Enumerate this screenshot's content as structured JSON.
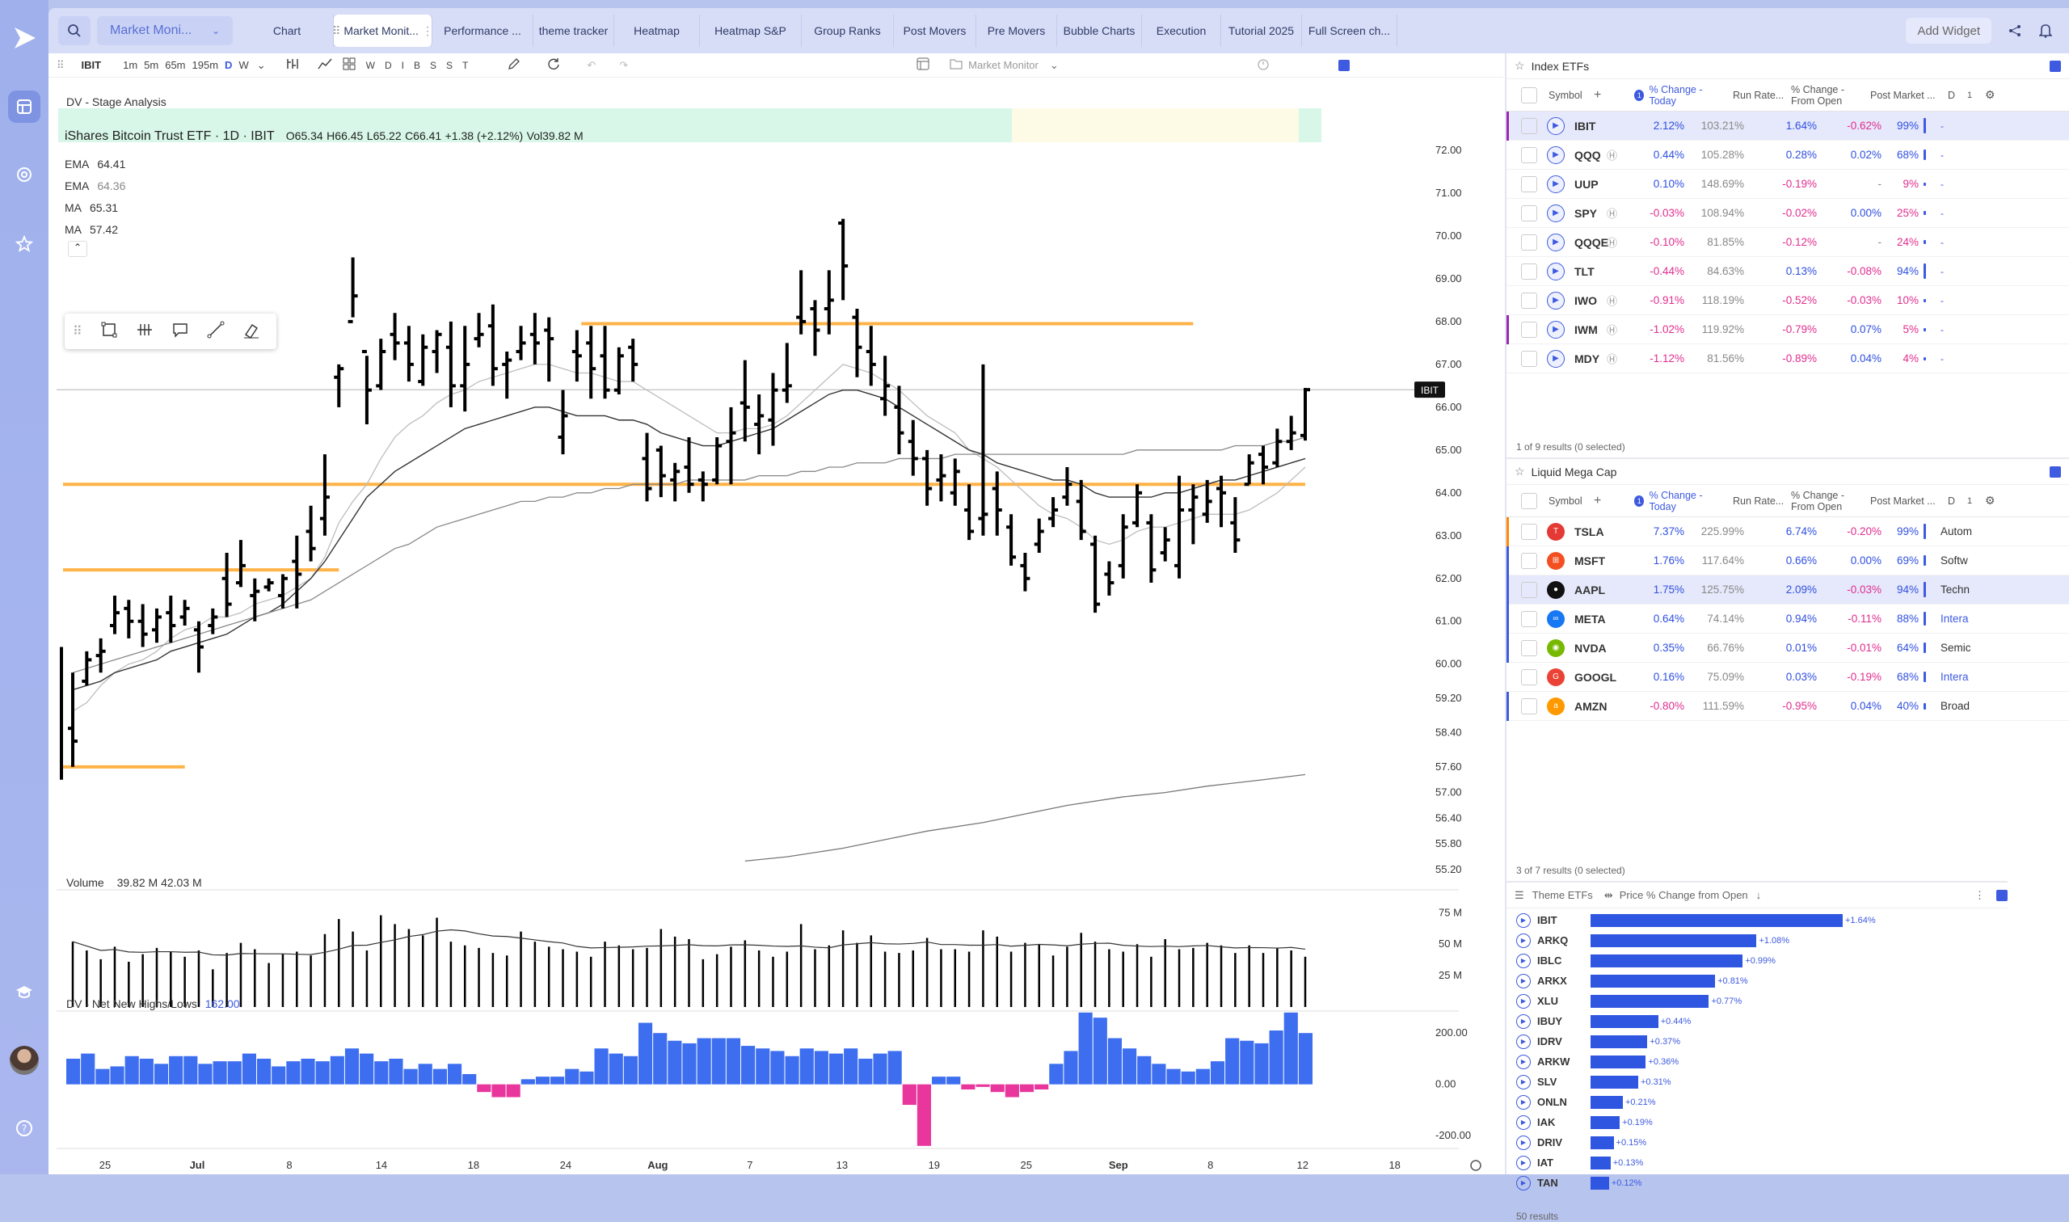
{
  "app": {
    "tabs": [
      "Chart",
      "Market Monit...",
      "Performance ...",
      "theme tracker",
      "Heatmap",
      "Heatmap S&P",
      "Group Ranks",
      "Post Movers",
      "Pre Movers",
      "Bubble Charts",
      "Execution",
      "Tutorial 2025",
      "Full Screen ch..."
    ],
    "layout_select": "Market Moni...",
    "add_widget": "Add Widget"
  },
  "chart": {
    "toolbar": {
      "symbol": "IBIT",
      "timeframes": [
        "1m",
        "5m",
        "65m",
        "195m",
        "D",
        "W"
      ],
      "letters": [
        "W",
        "D",
        "I",
        "B",
        "S",
        "S",
        "T"
      ],
      "layout_name": "Market Monitor"
    },
    "stage_label": "DV - Stage Analysis",
    "title": "iShares Bitcoin Trust ETF · 1D · IBIT",
    "ohlc": {
      "o": "O65.34",
      "h": "H66.45",
      "l": "L65.22",
      "c": "C66.41",
      "chg": "+1.38 (+2.12%)",
      "vol": "Vol39.82 M"
    },
    "indicators": [
      {
        "name": "EMA",
        "value": "64.41"
      },
      {
        "name": "EMA",
        "value": "64.36"
      },
      {
        "name": "MA",
        "value": "65.31"
      },
      {
        "name": "MA",
        "value": "57.42"
      }
    ],
    "price_label": "IBIT",
    "volume_label": "Volume",
    "volume_vals": "39.82 M  42.03 M",
    "nh_label": "DV - Net New Highs/Lows",
    "nh_value": "162.00",
    "price_ticks": [
      "72.00",
      "71.00",
      "70.00",
      "69.00",
      "68.00",
      "67.00",
      "66.00",
      "65.00",
      "64.00",
      "63.00",
      "62.00",
      "61.00",
      "60.00",
      "59.20",
      "58.40",
      "57.60",
      "57.00",
      "56.40",
      "55.80",
      "55.20"
    ],
    "volume_ticks": [
      "75 M",
      "50 M",
      "25 M"
    ],
    "nh_ticks": [
      "200.00",
      "0.00",
      "-200.00"
    ],
    "date_ticks": [
      "25",
      "Jul",
      "8",
      "14",
      "18",
      "24",
      "Aug",
      "7",
      "13",
      "19",
      "25",
      "Sep",
      "8",
      "12",
      "18"
    ]
  },
  "chart_data": {
    "type": "ohlc",
    "symbol": "IBIT",
    "ylim": [
      55.2,
      72.0
    ],
    "bars": [
      [
        58.5,
        59.8,
        57.6,
        58.2
      ],
      [
        59.6,
        60.3,
        59.5,
        60.1
      ],
      [
        60.2,
        60.6,
        59.8,
        60.3
      ],
      [
        60.9,
        61.6,
        60.7,
        61.2
      ],
      [
        61.3,
        61.5,
        60.6,
        61.0
      ],
      [
        61.0,
        61.4,
        60.4,
        60.7
      ],
      [
        60.8,
        61.3,
        60.5,
        61.1
      ],
      [
        61.2,
        61.6,
        60.5,
        60.9
      ],
      [
        61.1,
        61.5,
        60.9,
        61.3
      ],
      [
        60.8,
        61.0,
        59.8,
        60.4
      ],
      [
        60.9,
        61.3,
        60.7,
        61.1
      ],
      [
        62.0,
        62.6,
        61.1,
        61.4
      ],
      [
        61.9,
        62.9,
        61.8,
        62.3
      ],
      [
        61.6,
        62.0,
        61.0,
        61.7
      ],
      [
        61.8,
        62.0,
        61.7,
        61.9
      ],
      [
        61.6,
        62.1,
        61.3,
        62.0
      ],
      [
        62.4,
        63.0,
        61.3,
        62.1
      ],
      [
        63.1,
        63.7,
        62.4,
        62.7
      ],
      [
        63.4,
        64.9,
        63.0,
        63.9
      ],
      [
        66.7,
        67.0,
        66.0,
        66.9
      ],
      [
        68.0,
        69.5,
        68.1,
        68.6
      ],
      [
        67.3,
        67.2,
        65.6,
        66.4
      ],
      [
        66.5,
        67.6,
        66.4,
        67.3
      ],
      [
        67.7,
        68.2,
        67.1,
        67.5
      ],
      [
        67.5,
        67.9,
        66.6,
        67.0
      ],
      [
        66.6,
        67.7,
        66.5,
        67.4
      ],
      [
        67.3,
        67.8,
        66.8,
        67.7
      ],
      [
        67.4,
        68.0,
        66.0,
        66.5
      ],
      [
        66.5,
        67.9,
        65.9,
        67.0
      ],
      [
        67.6,
        68.2,
        67.4,
        67.7
      ],
      [
        67.9,
        68.4,
        66.5,
        66.9
      ],
      [
        67.0,
        67.3,
        66.2,
        67.1
      ],
      [
        67.3,
        67.9,
        67.1,
        67.5
      ],
      [
        67.7,
        68.2,
        67.0,
        67.5
      ],
      [
        67.8,
        68.1,
        66.6,
        67.6
      ],
      [
        65.3,
        66.4,
        64.9,
        65.8
      ],
      [
        67.3,
        67.8,
        66.6,
        67.2
      ],
      [
        67.5,
        67.9,
        66.2,
        66.9
      ],
      [
        67.2,
        67.9,
        66.2,
        66.4
      ],
      [
        66.4,
        67.4,
        66.3,
        67.2
      ],
      [
        67.4,
        67.6,
        66.6,
        67.0
      ],
      [
        64.8,
        65.4,
        63.8,
        64.1
      ],
      [
        65.0,
        65.1,
        63.9,
        64.4
      ],
      [
        64.3,
        64.7,
        63.8,
        64.5
      ],
      [
        64.6,
        65.3,
        64.0,
        64.2
      ],
      [
        64.3,
        64.5,
        63.8,
        64.2
      ],
      [
        64.3,
        65.3,
        64.2,
        65.1
      ],
      [
        65.2,
        66.0,
        64.2,
        65.4
      ],
      [
        66.1,
        67.1,
        65.2,
        66.0
      ],
      [
        65.6,
        66.3,
        64.9,
        65.8
      ],
      [
        65.7,
        66.8,
        65.1,
        66.4
      ],
      [
        66.4,
        67.5,
        66.1,
        66.5
      ],
      [
        68.1,
        69.2,
        67.7,
        68.0
      ],
      [
        68.3,
        68.5,
        67.2,
        67.8
      ],
      [
        68.3,
        69.2,
        67.7,
        68.5
      ],
      [
        70.3,
        70.4,
        68.5,
        69.3
      ],
      [
        68.1,
        68.3,
        66.7,
        67.4
      ],
      [
        67.3,
        67.9,
        66.5,
        67.0
      ],
      [
        66.2,
        67.2,
        65.8,
        66.5
      ],
      [
        66.0,
        66.5,
        64.9,
        65.4
      ],
      [
        65.2,
        65.7,
        64.4,
        64.8
      ],
      [
        64.8,
        65.0,
        63.7,
        64.1
      ],
      [
        64.3,
        64.9,
        63.8,
        64.4
      ],
      [
        64.0,
        64.8,
        63.7,
        64.5
      ],
      [
        63.6,
        64.2,
        62.9,
        63.1
      ],
      [
        63.4,
        67.0,
        63.0,
        63.5
      ],
      [
        64.1,
        64.5,
        63.0,
        63.6
      ],
      [
        63.2,
        63.5,
        62.3,
        62.5
      ],
      [
        62.3,
        62.6,
        61.7,
        62.0
      ],
      [
        62.8,
        63.4,
        62.6,
        63.1
      ],
      [
        63.4,
        63.9,
        63.2,
        63.6
      ],
      [
        63.9,
        64.6,
        63.7,
        64.2
      ],
      [
        63.8,
        64.3,
        62.9,
        63.1
      ],
      [
        62.8,
        63.0,
        61.2,
        61.4
      ],
      [
        62.1,
        62.4,
        61.6,
        61.9
      ],
      [
        62.3,
        63.5,
        62.0,
        63.2
      ],
      [
        63.3,
        64.2,
        63.2,
        64.0
      ],
      [
        63.3,
        63.5,
        61.9,
        62.2
      ],
      [
        62.6,
        63.2,
        62.4,
        62.9
      ],
      [
        62.3,
        64.4,
        62.0,
        63.6
      ],
      [
        63.6,
        64.2,
        62.8,
        63.9
      ],
      [
        63.5,
        64.3,
        63.3,
        63.8
      ],
      [
        64.1,
        64.4,
        63.2,
        64.0
      ],
      [
        63.3,
        63.9,
        62.6,
        62.9
      ],
      [
        64.2,
        64.9,
        64.2,
        64.7
      ],
      [
        64.9,
        65.1,
        64.2,
        64.6
      ],
      [
        64.7,
        65.5,
        64.6,
        65.2
      ],
      [
        65.2,
        65.8,
        65.0,
        65.4
      ],
      [
        65.34,
        66.45,
        65.22,
        66.41
      ]
    ],
    "volume_ylim": [
      0,
      90
    ],
    "volume": [
      52,
      45,
      38,
      48,
      36,
      42,
      47,
      44,
      40,
      45,
      30,
      43,
      51,
      46,
      35,
      42,
      44,
      41,
      58,
      70,
      60,
      45,
      73,
      66,
      62,
      57,
      71,
      52,
      49,
      47,
      43,
      41,
      60,
      52,
      48,
      46,
      44,
      40,
      52,
      49,
      46,
      47,
      62,
      56,
      54,
      38,
      42,
      48,
      53,
      45,
      40,
      44,
      66,
      46,
      49,
      61,
      51,
      57,
      44,
      43,
      45,
      55,
      46,
      46,
      44,
      61,
      56,
      44,
      51,
      50,
      41,
      48,
      59,
      52,
      46,
      44,
      50,
      40,
      54,
      46,
      47,
      51,
      49,
      43,
      49,
      43,
      47,
      45,
      40
    ],
    "nh_ylim": [
      -250,
      270
    ],
    "nh": [
      100,
      120,
      60,
      70,
      110,
      100,
      80,
      110,
      110,
      80,
      90,
      90,
      120,
      100,
      70,
      90,
      100,
      90,
      110,
      140,
      120,
      90,
      100,
      60,
      80,
      60,
      80,
      40,
      -30,
      -50,
      -50,
      20,
      30,
      30,
      60,
      50,
      140,
      120,
      110,
      240,
      200,
      170,
      160,
      180,
      180,
      180,
      150,
      140,
      130,
      110,
      140,
      130,
      120,
      140,
      100,
      120,
      130,
      -80,
      -240,
      30,
      30,
      -20,
      -10,
      -30,
      -50,
      -30,
      -20,
      80,
      130,
      280,
      260,
      180,
      140,
      110,
      80,
      60,
      50,
      60,
      90,
      180,
      170,
      160,
      210,
      280,
      200
    ],
    "ma_series": {
      "ma_light": [
        58.9,
        59.1,
        59.5,
        59.8,
        60.0,
        60.1,
        60.3,
        60.6,
        60.8,
        60.9,
        61.1,
        61.1,
        61.2,
        61.4,
        61.5,
        61.6,
        61.8,
        62.0,
        62.5,
        63.3,
        63.8,
        64.2,
        64.8,
        65.3,
        65.6,
        65.8,
        66.1,
        66.3,
        66.4,
        66.6,
        66.7,
        66.8,
        66.9,
        67.0,
        67.0,
        66.9,
        66.8,
        66.8,
        66.7,
        66.6,
        66.6,
        66.4,
        66.2,
        66.0,
        65.8,
        65.6,
        65.4,
        65.4,
        65.5,
        65.5,
        65.6,
        65.8,
        66.1,
        66.4,
        66.7,
        67.0,
        66.9,
        66.8,
        66.6,
        66.4,
        66.1,
        65.8,
        65.6,
        65.4,
        65.0,
        64.8,
        64.6,
        64.3,
        64.0,
        63.7,
        63.5,
        63.4,
        63.2,
        62.9,
        62.8,
        62.9,
        63.1,
        63.2,
        63.2,
        63.3,
        63.4,
        63.5,
        63.5,
        63.5,
        63.6,
        63.8,
        64.0,
        64.3,
        64.6
      ],
      "ma_dark": [
        59.4,
        59.5,
        59.6,
        59.8,
        59.9,
        60.0,
        60.1,
        60.3,
        60.4,
        60.5,
        60.6,
        60.7,
        60.9,
        61.1,
        61.2,
        61.4,
        61.7,
        62.0,
        62.4,
        62.9,
        63.4,
        63.9,
        64.2,
        64.5,
        64.7,
        64.9,
        65.1,
        65.3,
        65.5,
        65.6,
        65.7,
        65.8,
        65.9,
        66.0,
        66.0,
        65.9,
        65.8,
        65.8,
        65.8,
        65.7,
        65.7,
        65.6,
        65.4,
        65.3,
        65.2,
        65.1,
        65.1,
        65.2,
        65.3,
        65.4,
        65.5,
        65.7,
        65.9,
        66.1,
        66.3,
        66.4,
        66.4,
        66.3,
        66.2,
        66.0,
        65.8,
        65.6,
        65.4,
        65.2,
        65.0,
        64.9,
        64.7,
        64.6,
        64.5,
        64.4,
        64.3,
        64.3,
        64.2,
        64.0,
        63.9,
        63.9,
        63.9,
        63.9,
        64.0,
        64.0,
        64.1,
        64.2,
        64.3,
        64.3,
        64.4,
        64.5,
        64.6,
        64.7,
        64.8
      ],
      "ma_long": [
        59.8,
        59.9,
        60.0,
        60.1,
        60.2,
        60.3,
        60.4,
        60.5,
        60.6,
        60.7,
        60.8,
        60.9,
        61.0,
        61.1,
        61.2,
        61.3,
        61.4,
        61.5,
        61.7,
        61.9,
        62.1,
        62.3,
        62.5,
        62.7,
        62.8,
        63.0,
        63.2,
        63.3,
        63.4,
        63.5,
        63.6,
        63.7,
        63.8,
        63.8,
        63.9,
        63.9,
        64.0,
        64.0,
        64.1,
        64.1,
        64.2,
        64.2,
        64.2,
        64.2,
        64.3,
        64.3,
        64.3,
        64.3,
        64.3,
        64.4,
        64.4,
        64.4,
        64.5,
        64.5,
        64.6,
        64.6,
        64.7,
        64.7,
        64.7,
        64.8,
        64.8,
        64.8,
        64.8,
        64.9,
        64.9,
        64.9,
        64.9,
        64.9,
        64.9,
        64.9,
        64.9,
        64.9,
        64.9,
        64.9,
        64.9,
        64.9,
        65.0,
        65.0,
        65.0,
        65.0,
        65.0,
        65.0,
        65.0,
        65.1,
        65.1,
        65.1,
        65.2,
        65.2,
        65.3
      ]
    },
    "hlines": [
      {
        "y": 67.95,
        "from": 37,
        "to": 80
      },
      {
        "y": 64.2,
        "from": 0,
        "to": 88
      },
      {
        "y": 62.2,
        "from": 0,
        "to": 19
      },
      {
        "y": 57.6,
        "from": 0,
        "to": 8
      }
    ]
  },
  "index_etfs": {
    "title": "Index ETFs",
    "headers": [
      "Symbol",
      "% Change - Today",
      "Run Rate...",
      "% Change - From Open",
      "Post Market ...",
      "D"
    ],
    "rows": [
      {
        "sym": "IBIT",
        "chg": "2.12%",
        "run": "103.21%",
        "open": "1.64%",
        "post": "-0.62%",
        "d": "99%"
      },
      {
        "sym": "QQQ",
        "chg": "0.44%",
        "run": "105.28%",
        "open": "0.28%",
        "post": "0.02%",
        "d": "68%"
      },
      {
        "sym": "UUP",
        "chg": "0.10%",
        "run": "148.69%",
        "open": "-0.19%",
        "post": "-",
        "d": "9%"
      },
      {
        "sym": "SPY",
        "chg": "-0.03%",
        "run": "108.94%",
        "open": "-0.02%",
        "post": "0.00%",
        "d": "25%"
      },
      {
        "sym": "QQQE",
        "chg": "-0.10%",
        "run": "81.85%",
        "open": "-0.12%",
        "post": "-",
        "d": "24%"
      },
      {
        "sym": "TLT",
        "chg": "-0.44%",
        "run": "84.63%",
        "open": "0.13%",
        "post": "-0.08%",
        "d": "94%"
      },
      {
        "sym": "IWO",
        "chg": "-0.91%",
        "run": "118.19%",
        "open": "-0.52%",
        "post": "-0.03%",
        "d": "10%"
      },
      {
        "sym": "IWM",
        "chg": "-1.02%",
        "run": "119.92%",
        "open": "-0.79%",
        "post": "0.07%",
        "d": "5%"
      },
      {
        "sym": "MDY",
        "chg": "-1.12%",
        "run": "81.56%",
        "open": "-0.89%",
        "post": "0.04%",
        "d": "4%"
      }
    ],
    "footer": "1 of 9 results (0 selected)"
  },
  "mega_cap": {
    "title": "Liquid Mega Cap",
    "headers": [
      "Symbol",
      "% Change - Today",
      "Run Rate...",
      "% Change - From Open",
      "Post Market ...",
      "D"
    ],
    "rows": [
      {
        "sym": "TSLA",
        "chg": "7.37%",
        "run": "225.99%",
        "open": "6.74%",
        "post": "-0.20%",
        "d": "99%",
        "cat": "Autom",
        "icon": "T",
        "color": "#e53935"
      },
      {
        "sym": "MSFT",
        "chg": "1.76%",
        "run": "117.64%",
        "open": "0.66%",
        "post": "0.00%",
        "d": "69%",
        "cat": "Softw",
        "icon": "⊞",
        "color": "#f25022"
      },
      {
        "sym": "AAPL",
        "chg": "1.75%",
        "run": "125.75%",
        "open": "2.09%",
        "post": "-0.03%",
        "d": "94%",
        "cat": "Techn",
        "icon": "●",
        "color": "#111111"
      },
      {
        "sym": "META",
        "chg": "0.64%",
        "run": "74.14%",
        "open": "0.94%",
        "post": "-0.11%",
        "d": "88%",
        "cat": "Intera",
        "icon": "∞",
        "color": "#1877f2"
      },
      {
        "sym": "NVDA",
        "chg": "0.35%",
        "run": "66.76%",
        "open": "0.01%",
        "post": "-0.01%",
        "d": "64%",
        "cat": "Semic",
        "icon": "◉",
        "color": "#76b900"
      },
      {
        "sym": "GOOGL",
        "chg": "0.16%",
        "run": "75.09%",
        "open": "0.03%",
        "post": "-0.19%",
        "d": "68%",
        "cat": "Intera",
        "icon": "G",
        "color": "#ea4335"
      },
      {
        "sym": "AMZN",
        "chg": "-0.80%",
        "run": "111.59%",
        "open": "-0.95%",
        "post": "0.04%",
        "d": "40%",
        "cat": "Broad",
        "icon": "a",
        "color": "#ff9900"
      }
    ],
    "footer": "3 of 7 results (0 selected)"
  },
  "theme_etfs": {
    "title": "Theme ETFs",
    "metric": "Price % Change from Open",
    "rows": [
      {
        "sym": "IBIT",
        "label": "+1.64%",
        "value": 1.64
      },
      {
        "sym": "ARKQ",
        "label": "+1.08%",
        "value": 1.08
      },
      {
        "sym": "IBLC",
        "label": "+0.99%",
        "value": 0.99
      },
      {
        "sym": "ARKX",
        "label": "+0.81%",
        "value": 0.81
      },
      {
        "sym": "XLU",
        "label": "+0.77%",
        "value": 0.77
      },
      {
        "sym": "IBUY",
        "label": "+0.44%",
        "value": 0.44
      },
      {
        "sym": "IDRV",
        "label": "+0.37%",
        "value": 0.37
      },
      {
        "sym": "ARKW",
        "label": "+0.36%",
        "value": 0.36
      },
      {
        "sym": "SLV",
        "label": "+0.31%",
        "value": 0.31
      },
      {
        "sym": "ONLN",
        "label": "+0.21%",
        "value": 0.21
      },
      {
        "sym": "IAK",
        "label": "+0.19%",
        "value": 0.19
      },
      {
        "sym": "DRIV",
        "label": "+0.15%",
        "value": 0.15
      },
      {
        "sym": "IAT",
        "label": "+0.13%",
        "value": 0.13
      },
      {
        "sym": "TAN",
        "label": "+0.12%",
        "value": 0.12
      }
    ],
    "footer": "50 results"
  },
  "colors": {
    "accent": "#3d5ae0",
    "positive": "#2f4fe0",
    "negative": "#e02d8f",
    "orange": "#ffb347",
    "stage_green": "#d8f7e8",
    "stage_yellow": "#fdfbe5"
  }
}
